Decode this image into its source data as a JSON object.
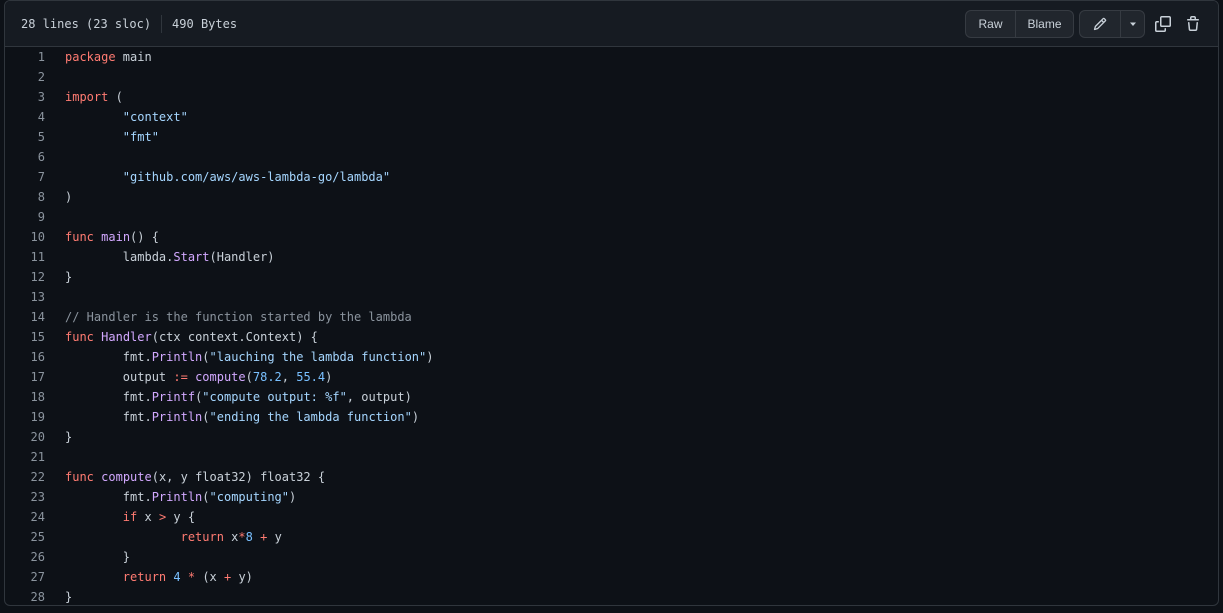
{
  "file_header": {
    "lines_info": "28 lines (23 sloc)",
    "size_info": "490 Bytes",
    "raw_label": "Raw",
    "blame_label": "Blame"
  },
  "icons": {
    "edit": "pencil-icon",
    "caret": "caret-down-icon",
    "copy": "copy-icon",
    "delete": "trash-icon"
  },
  "colors": {
    "background": "#0d1117",
    "header_bg": "#161b22",
    "border": "#30363d",
    "text": "#c9d1d9",
    "keyword": "#ff7b72",
    "function": "#d2a8ff",
    "string": "#a5d6ff",
    "number": "#79c0ff",
    "comment": "#8b949e"
  },
  "code": {
    "lines": [
      [
        {
          "t": "package",
          "c": "kw"
        },
        {
          "t": " main"
        }
      ],
      [],
      [
        {
          "t": "import",
          "c": "kw"
        },
        {
          "t": " ("
        }
      ],
      [
        {
          "t": "\t"
        },
        {
          "t": "\"context\"",
          "c": "str"
        }
      ],
      [
        {
          "t": "\t"
        },
        {
          "t": "\"fmt\"",
          "c": "str"
        }
      ],
      [],
      [
        {
          "t": "\t"
        },
        {
          "t": "\"github.com/aws/aws-lambda-go/lambda\"",
          "c": "str"
        }
      ],
      [
        {
          "t": ")"
        }
      ],
      [],
      [
        {
          "t": "func",
          "c": "kw"
        },
        {
          "t": " "
        },
        {
          "t": "main",
          "c": "fn"
        },
        {
          "t": "() {"
        }
      ],
      [
        {
          "t": "\tlambda."
        },
        {
          "t": "Start",
          "c": "call"
        },
        {
          "t": "(Handler)"
        }
      ],
      [
        {
          "t": "}"
        }
      ],
      [],
      [
        {
          "t": "// Handler is the function started by the lambda",
          "c": "cm"
        }
      ],
      [
        {
          "t": "func",
          "c": "kw"
        },
        {
          "t": " "
        },
        {
          "t": "Handler",
          "c": "fn"
        },
        {
          "t": "(ctx context.Context) {"
        }
      ],
      [
        {
          "t": "\tfmt."
        },
        {
          "t": "Println",
          "c": "call"
        },
        {
          "t": "("
        },
        {
          "t": "\"lauching the lambda function\"",
          "c": "str"
        },
        {
          "t": ")"
        }
      ],
      [
        {
          "t": "\toutput "
        },
        {
          "t": ":=",
          "c": "op"
        },
        {
          "t": " "
        },
        {
          "t": "compute",
          "c": "call"
        },
        {
          "t": "("
        },
        {
          "t": "78.2",
          "c": "num"
        },
        {
          "t": ", "
        },
        {
          "t": "55.4",
          "c": "num"
        },
        {
          "t": ")"
        }
      ],
      [
        {
          "t": "\tfmt."
        },
        {
          "t": "Printf",
          "c": "call"
        },
        {
          "t": "("
        },
        {
          "t": "\"compute output: %f\"",
          "c": "str"
        },
        {
          "t": ", output)"
        }
      ],
      [
        {
          "t": "\tfmt."
        },
        {
          "t": "Println",
          "c": "call"
        },
        {
          "t": "("
        },
        {
          "t": "\"ending the lambda function\"",
          "c": "str"
        },
        {
          "t": ")"
        }
      ],
      [
        {
          "t": "}"
        }
      ],
      [],
      [
        {
          "t": "func",
          "c": "kw"
        },
        {
          "t": " "
        },
        {
          "t": "compute",
          "c": "fn"
        },
        {
          "t": "(x, y float32) float32 {"
        }
      ],
      [
        {
          "t": "\tfmt."
        },
        {
          "t": "Println",
          "c": "call"
        },
        {
          "t": "("
        },
        {
          "t": "\"computing\"",
          "c": "str"
        },
        {
          "t": ")"
        }
      ],
      [
        {
          "t": "\t"
        },
        {
          "t": "if",
          "c": "kw"
        },
        {
          "t": " x "
        },
        {
          "t": ">",
          "c": "op"
        },
        {
          "t": " y {"
        }
      ],
      [
        {
          "t": "\t\t"
        },
        {
          "t": "return",
          "c": "kw"
        },
        {
          "t": " x"
        },
        {
          "t": "*",
          "c": "op"
        },
        {
          "t": "8",
          "c": "num"
        },
        {
          "t": " "
        },
        {
          "t": "+",
          "c": "op"
        },
        {
          "t": " y"
        }
      ],
      [
        {
          "t": "\t}"
        }
      ],
      [
        {
          "t": "\t"
        },
        {
          "t": "return",
          "c": "kw"
        },
        {
          "t": " "
        },
        {
          "t": "4",
          "c": "num"
        },
        {
          "t": " "
        },
        {
          "t": "*",
          "c": "op"
        },
        {
          "t": " (x "
        },
        {
          "t": "+",
          "c": "op"
        },
        {
          "t": " y)"
        }
      ],
      [
        {
          "t": "}"
        }
      ]
    ]
  }
}
